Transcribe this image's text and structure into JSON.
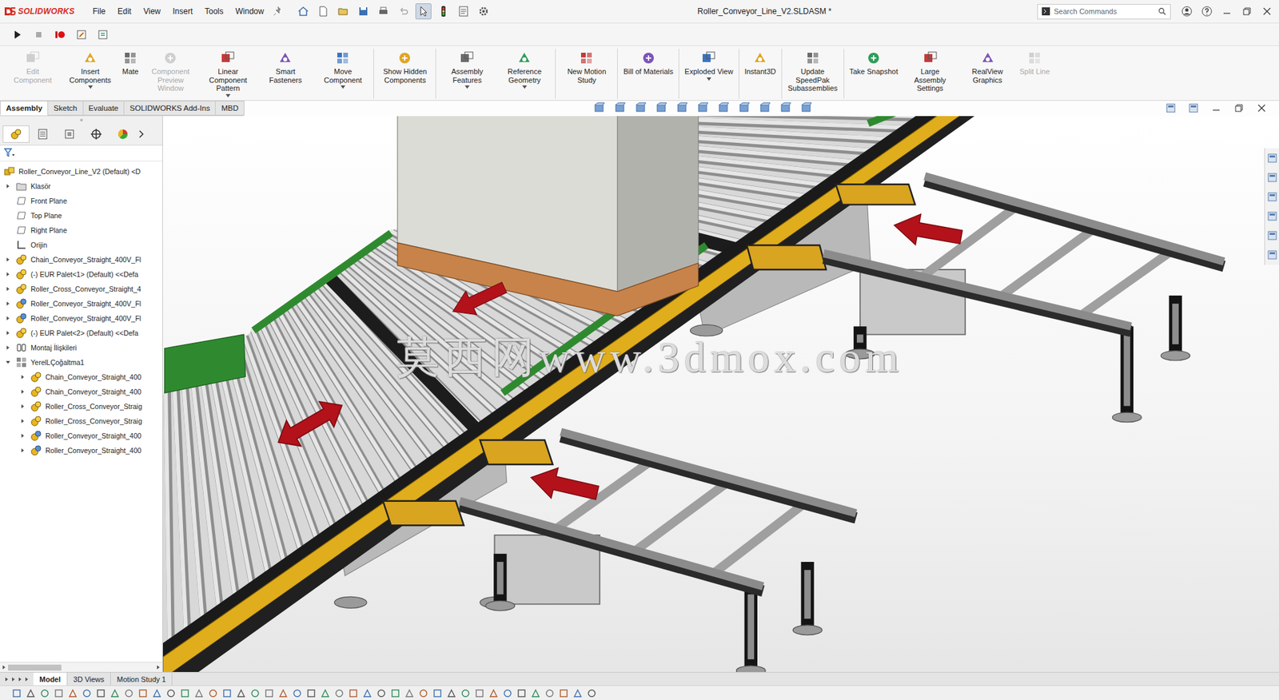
{
  "app": {
    "logo": "SOLIDWORKS"
  },
  "menu": [
    "File",
    "Edit",
    "View",
    "Insert",
    "Tools",
    "Window"
  ],
  "toolbar": {
    "select_tool_active": true
  },
  "window": {
    "title": "Roller_Conveyor_Line_V2.SLDASM *"
  },
  "search": {
    "placeholder": "Search Commands"
  },
  "commands": [
    {
      "label": "Edit Component",
      "disabled": true,
      "dropdown": false
    },
    {
      "label": "Insert Components",
      "disabled": false,
      "dropdown": true
    },
    {
      "label": "Mate",
      "disabled": false,
      "dropdown": false
    },
    {
      "label": "Component Preview Window",
      "disabled": true,
      "dropdown": false
    },
    {
      "label": "Linear Component Pattern",
      "disabled": false,
      "dropdown": true
    },
    {
      "label": "Smart Fasteners",
      "disabled": false,
      "dropdown": false
    },
    {
      "label": "Move Component",
      "disabled": false,
      "dropdown": true
    },
    {
      "label": "Show Hidden Components",
      "disabled": false,
      "dropdown": false
    },
    {
      "label": "Assembly Features",
      "disabled": false,
      "dropdown": true
    },
    {
      "label": "Reference Geometry",
      "disabled": false,
      "dropdown": true
    },
    {
      "label": "New Motion Study",
      "disabled": false,
      "dropdown": false
    },
    {
      "label": "Bill of Materials",
      "disabled": false,
      "dropdown": false
    },
    {
      "label": "Exploded View",
      "disabled": false,
      "dropdown": true
    },
    {
      "label": "Instant3D",
      "disabled": false,
      "dropdown": false
    },
    {
      "label": "Update SpeedPak Subassemblies",
      "disabled": false,
      "dropdown": false
    },
    {
      "label": "Take Snapshot",
      "disabled": false,
      "dropdown": false
    },
    {
      "label": "Large Assembly Settings",
      "disabled": false,
      "dropdown": false
    },
    {
      "label": "RealView Graphics",
      "disabled": false,
      "dropdown": false
    },
    {
      "label": "Split Line",
      "disabled": true,
      "dropdown": false
    }
  ],
  "tabs": [
    {
      "label": "Assembly",
      "selected": true
    },
    {
      "label": "Sketch",
      "selected": false
    },
    {
      "label": "Evaluate",
      "selected": false
    },
    {
      "label": "SOLIDWORKS Add-Ins",
      "selected": false
    },
    {
      "label": "MBD",
      "selected": false
    }
  ],
  "tree": [
    {
      "label": "Roller_Conveyor_Line_V2 (Default) <D",
      "kind": "assembly",
      "level": 0,
      "expandable": false,
      "expanded": false
    },
    {
      "label": "Klasör",
      "kind": "folder",
      "level": 1,
      "expandable": true,
      "expanded": false
    },
    {
      "label": "Front Plane",
      "kind": "plane",
      "level": 1,
      "expandable": false,
      "expanded": false
    },
    {
      "label": "Top Plane",
      "kind": "plane",
      "level": 1,
      "expandable": false,
      "expanded": false
    },
    {
      "label": "Right Plane",
      "kind": "plane",
      "level": 1,
      "expandable": false,
      "expanded": false
    },
    {
      "label": "Orijin",
      "kind": "origin",
      "level": 1,
      "expandable": false,
      "expanded": false
    },
    {
      "label": "Chain_Conveyor_Straight_400V_Fl",
      "kind": "subassembly",
      "level": 1,
      "expandable": true,
      "expanded": false
    },
    {
      "label": "(-) EUR Palet<1> (Default) <<Defa",
      "kind": "subassembly",
      "level": 1,
      "expandable": true,
      "expanded": false
    },
    {
      "label": "Roller_Cross_Conveyor_Straight_4",
      "kind": "subassembly",
      "level": 1,
      "expandable": true,
      "expanded": false
    },
    {
      "label": "Roller_Conveyor_Straight_400V_Fl",
      "kind": "flexible",
      "level": 1,
      "expandable": true,
      "expanded": false
    },
    {
      "label": "Roller_Conveyor_Straight_400V_Fl",
      "kind": "flexible",
      "level": 1,
      "expandable": true,
      "expanded": false
    },
    {
      "label": "(-) EUR Palet<2> (Default) <<Defa",
      "kind": "subassembly",
      "level": 1,
      "expandable": true,
      "expanded": false
    },
    {
      "label": "Montaj İlişkileri",
      "kind": "mates",
      "level": 1,
      "expandable": true,
      "expanded": false
    },
    {
      "label": "YerelLÇoğaltma1",
      "kind": "pattern",
      "level": 1,
      "expandable": true,
      "expanded": true
    },
    {
      "label": "Chain_Conveyor_Straight_400",
      "kind": "subassembly",
      "level": 2,
      "expandable": true,
      "expanded": false
    },
    {
      "label": "Chain_Conveyor_Straight_400",
      "kind": "subassembly",
      "level": 2,
      "expandable": true,
      "expanded": false
    },
    {
      "label": "Roller_Cross_Conveyor_Straig",
      "kind": "subassembly",
      "level": 2,
      "expandable": true,
      "expanded": false
    },
    {
      "label": "Roller_Cross_Conveyor_Straig",
      "kind": "subassembly",
      "level": 2,
      "expandable": true,
      "expanded": false
    },
    {
      "label": "Roller_Conveyor_Straight_400",
      "kind": "flexible",
      "level": 2,
      "expandable": true,
      "expanded": false
    },
    {
      "label": "Roller_Conveyor_Straight_400",
      "kind": "flexible",
      "level": 2,
      "expandable": true,
      "expanded": false
    }
  ],
  "viewport": {
    "watermark": "莫西网www.3dmox.com"
  },
  "bottom_tabs": [
    {
      "label": "Model",
      "selected": true
    },
    {
      "label": "3D Views",
      "selected": false
    },
    {
      "label": "Motion Study 1",
      "selected": false
    }
  ]
}
